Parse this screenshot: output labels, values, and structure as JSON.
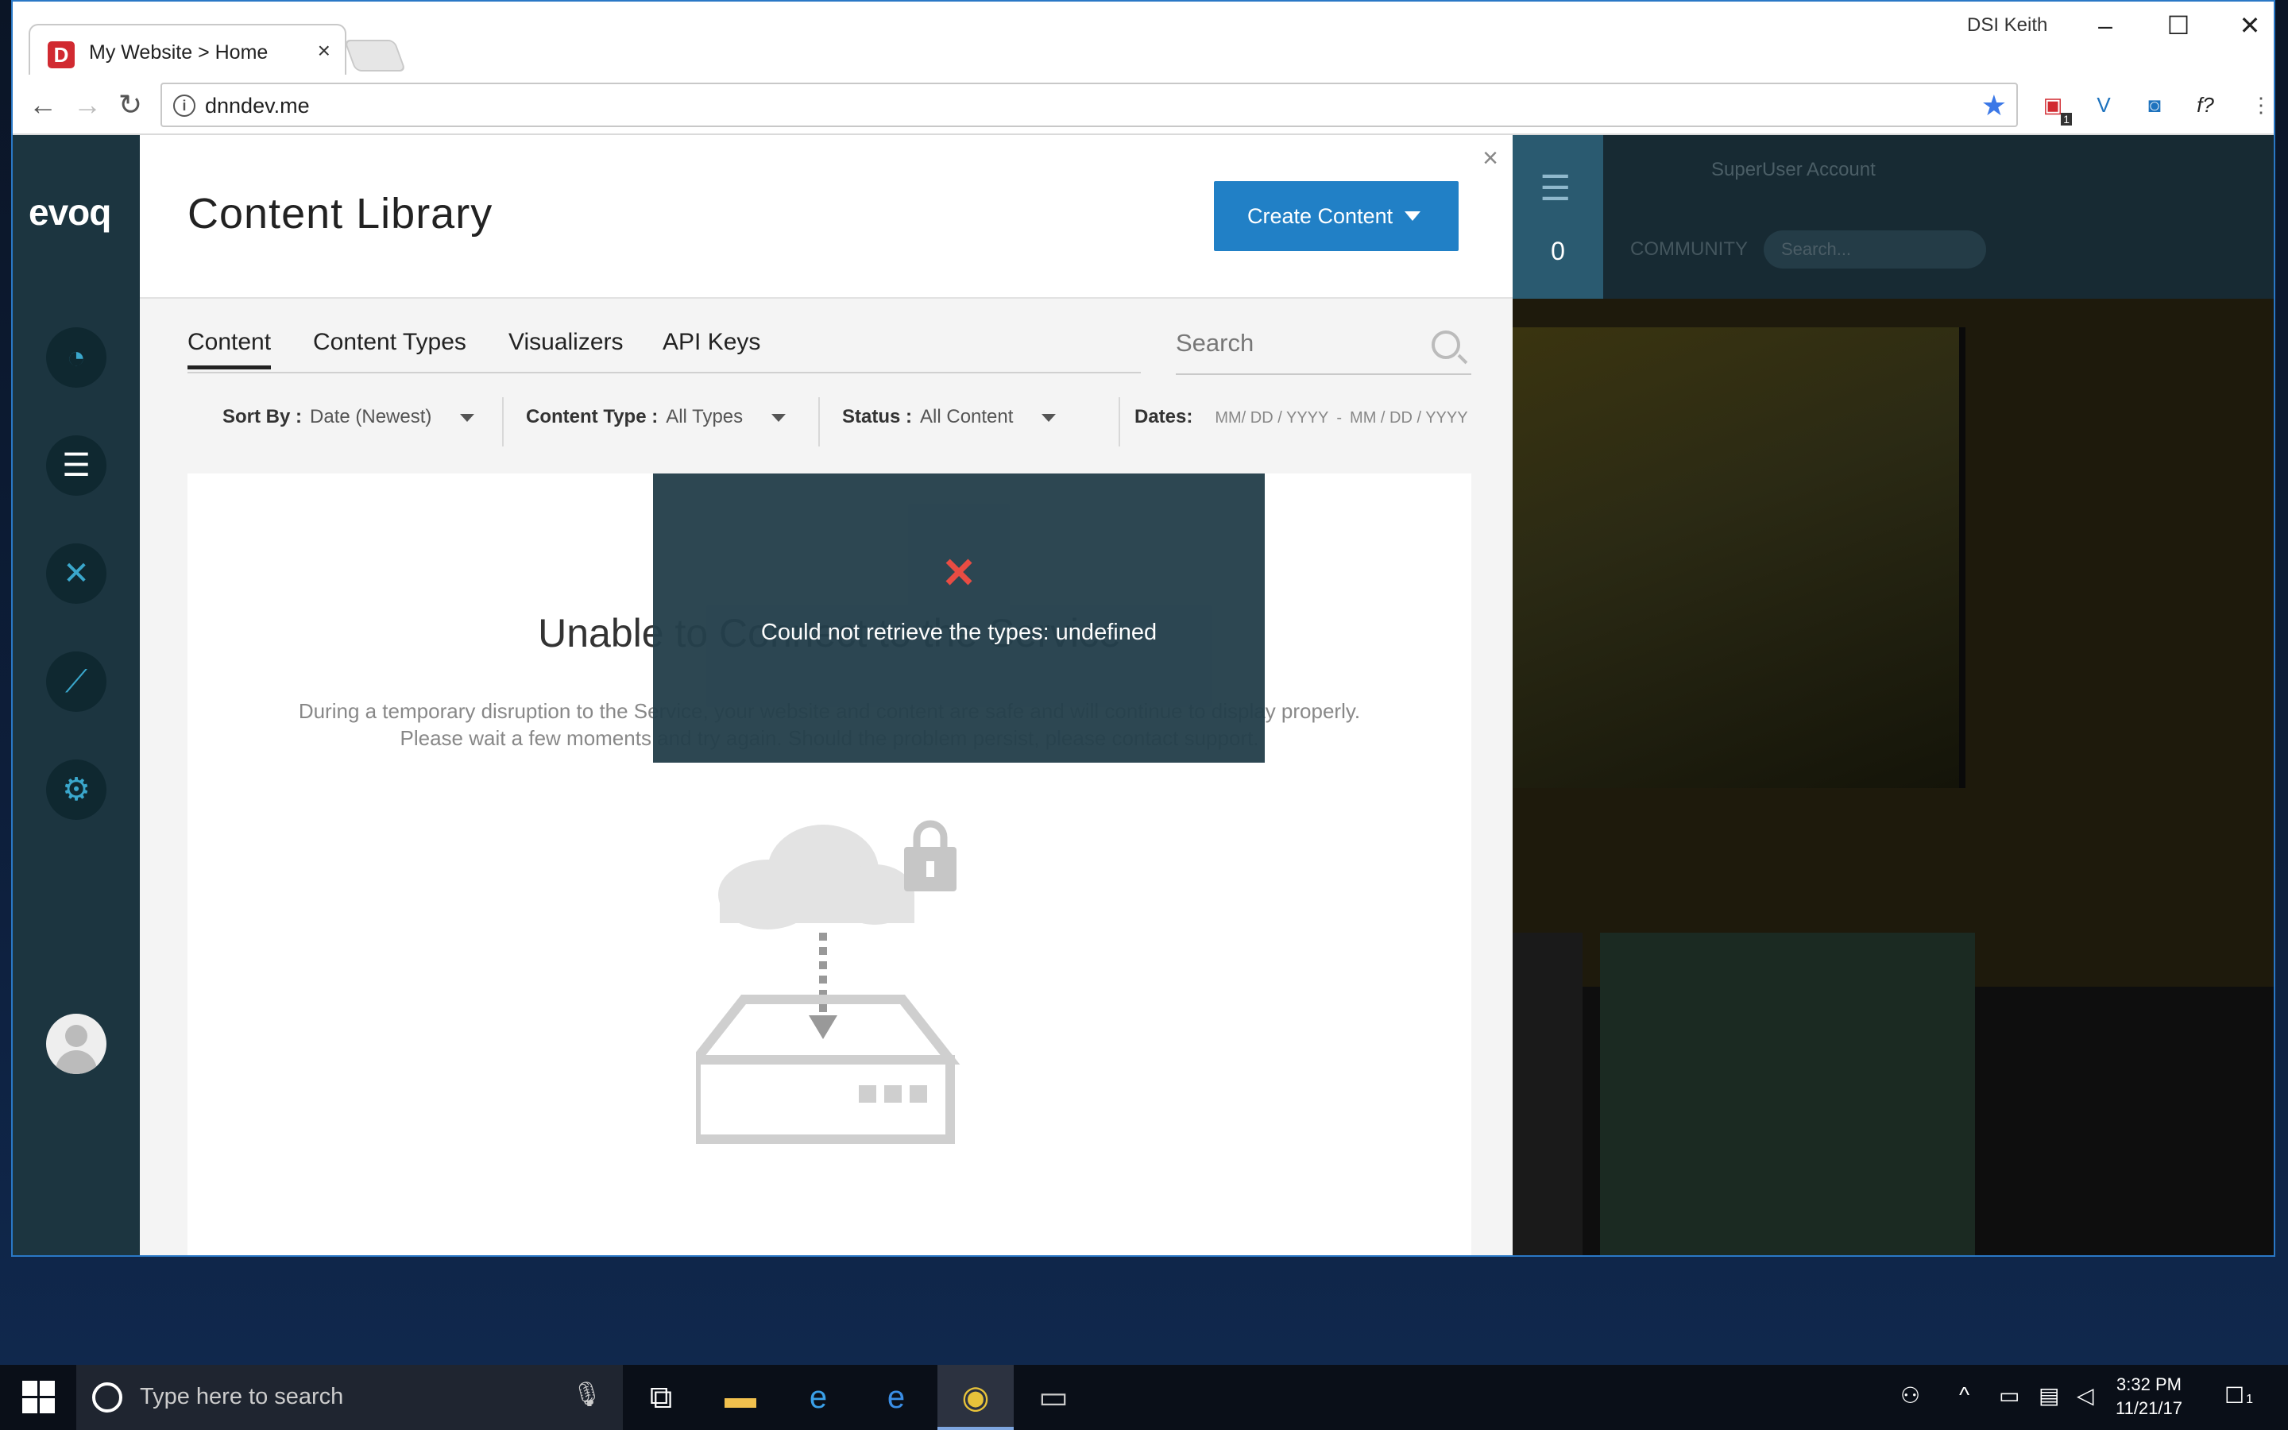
{
  "browser": {
    "tab_title": "My Website > Home",
    "tab_favicon": "D",
    "profile_name": "DSI Keith",
    "url": "dnndev.me",
    "extension_badge": "1"
  },
  "sidebar": {
    "logo": "evoq"
  },
  "panel": {
    "title": "Content Library",
    "create_button": "Create Content",
    "tabs": [
      "Content",
      "Content Types",
      "Visualizers",
      "API Keys"
    ],
    "search_placeholder": "Search",
    "filters": {
      "sort_label": "Sort By :",
      "sort_value": "Date (Newest)",
      "type_label": "Content Type :",
      "type_value": "All Types",
      "status_label": "Status :",
      "status_value": "All Content",
      "dates_label": "Dates:",
      "date_from": "MM/ DD / YYYY",
      "date_sep": "-",
      "date_to": "MM / DD / YYYY"
    },
    "empty": {
      "title": "Unable to Connect to the Service",
      "description": "During a temporary disruption to the Service, your website and content are safe and will continue to display properly. Please wait a few moments and try again. Should the problem persist, please contact support."
    },
    "toast": {
      "icon": "×",
      "message": "Could not retrieve the types: undefined"
    }
  },
  "site": {
    "count": "0",
    "user": "SuperUser Account",
    "nav_item": "COMMUNITY",
    "search_placeholder": "Search..."
  },
  "taskbar": {
    "search_placeholder": "Type here to search",
    "time": "3:32 PM",
    "date": "11/21/17",
    "notification_count": "1"
  },
  "colors": {
    "accent_blue": "#2180c6",
    "sidebar": "#1c3540",
    "toast_bg": "#243f4b",
    "error_red": "#e8453c"
  }
}
